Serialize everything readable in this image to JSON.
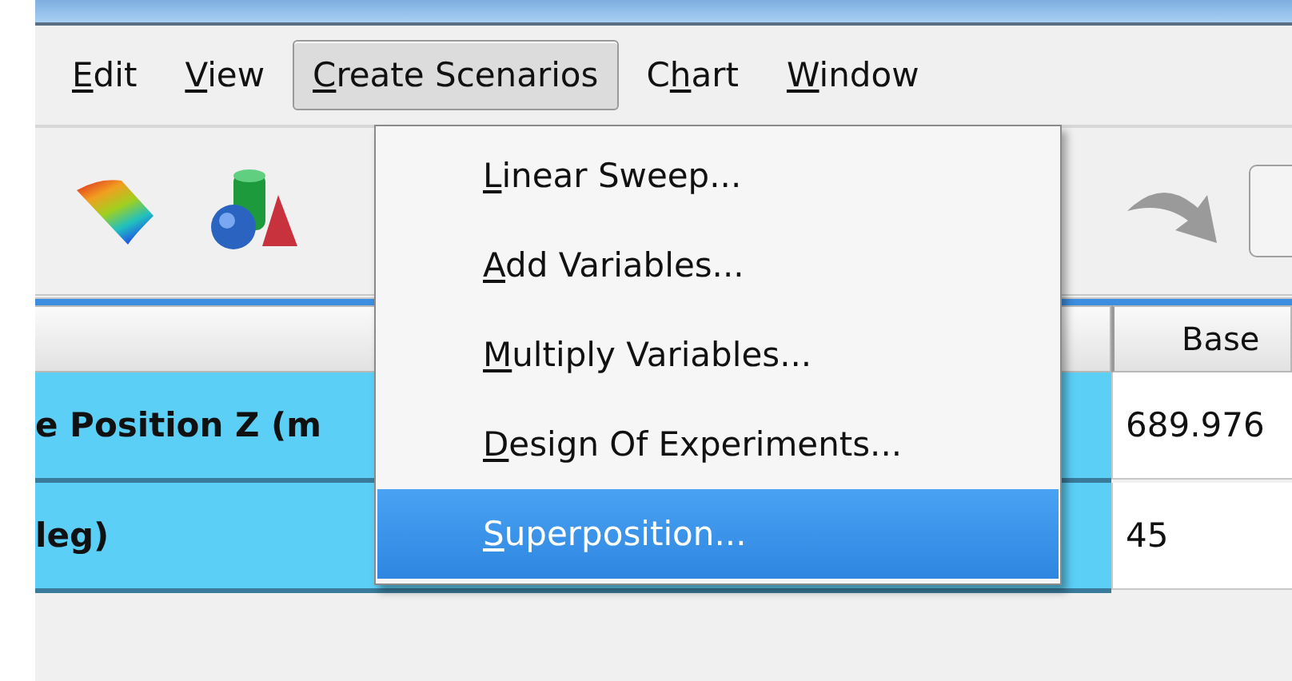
{
  "menubar": [
    {
      "key": "E",
      "after": "dit",
      "selected": false
    },
    {
      "key": "V",
      "after": "iew",
      "selected": false
    },
    {
      "key": "C",
      "after": "reate Scenarios",
      "selected": true
    },
    {
      "before": "C",
      "key": "h",
      "after": "art",
      "selected": false
    },
    {
      "key": "W",
      "after": "indow",
      "selected": false
    }
  ],
  "menu": {
    "items": [
      {
        "key": "L",
        "after": "inear Sweep...",
        "selected": false
      },
      {
        "key": "A",
        "after": "dd Variables...",
        "selected": false
      },
      {
        "key": "M",
        "after": "ultiply Variables...",
        "selected": false
      },
      {
        "key": "D",
        "after": "esign Of Experiments...",
        "selected": false
      },
      {
        "key": "S",
        "after": "uperposition...",
        "selected": true
      }
    ]
  },
  "table": {
    "columns": [
      "Base"
    ],
    "rows": [
      {
        "name": "e Position Z (m",
        "value": "689.976"
      },
      {
        "name": "leg)",
        "value": "45"
      }
    ]
  }
}
